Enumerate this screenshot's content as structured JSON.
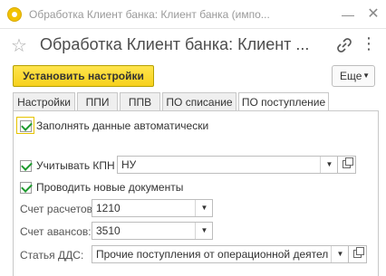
{
  "window": {
    "title": "Обработка Клиент банка: Клиент банка (импо...",
    "minimize_symbol": "—",
    "close_symbol": "✕"
  },
  "form": {
    "title": "Обработка Клиент банка: Клиент ...",
    "star_symbol": "☆",
    "link_icon": "link-icon",
    "more_symbol": "⋮"
  },
  "toolbar": {
    "apply_label": "Установить настройки",
    "more_label": "Еще",
    "caret_symbol": "▼"
  },
  "tabs": [
    {
      "label": "Настройки",
      "active": false
    },
    {
      "label": "ППИ",
      "active": false
    },
    {
      "label": "ППВ",
      "active": false
    },
    {
      "label": "ПО списание",
      "active": false
    },
    {
      "label": "ПО поступление",
      "active": true
    }
  ],
  "panel": {
    "auto_fill_label": "Заполнять данные автоматически",
    "auto_fill_checked": true,
    "kpn_label": "Учитывать КПН",
    "kpn_checked": true,
    "kpn_value": "НУ",
    "new_docs_label": "Проводить новые документы",
    "new_docs_checked": true,
    "settlements_label": "Счет расчетов:",
    "settlements_value": "1210",
    "advances_label": "Счет авансов:",
    "advances_value": "3510",
    "dds_label": "Статья ДДС:",
    "dds_value": "Прочие поступления от операционной деятельнос",
    "dropdown_symbol": "▼"
  },
  "colors": {
    "accent_yellow": "#f7d11c",
    "check_green": "#1e9a2e"
  }
}
